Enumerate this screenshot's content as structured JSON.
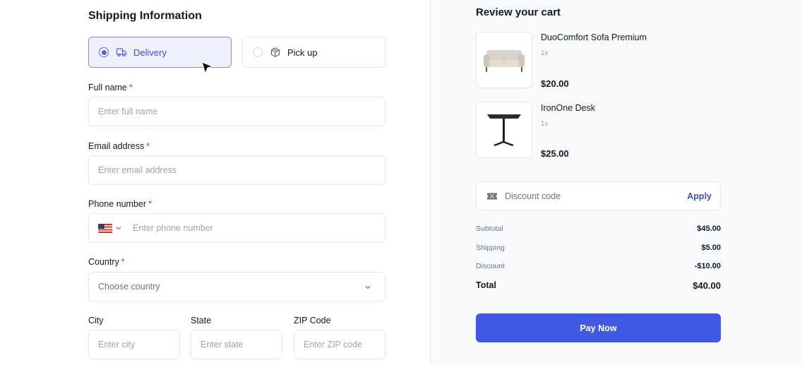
{
  "shipping": {
    "title": "Shipping Information",
    "methods": [
      {
        "label": "Delivery",
        "selected": true,
        "icon": "truck-icon"
      },
      {
        "label": "Pick up",
        "selected": false,
        "icon": "box-icon"
      }
    ],
    "fields": {
      "full_name": {
        "label": "Full name",
        "placeholder": "Enter full name",
        "required": "*"
      },
      "email": {
        "label": "Email address",
        "placeholder": "Enter email address",
        "required": "*"
      },
      "phone": {
        "label": "Phone number",
        "placeholder": "Enter phone number",
        "required": "*",
        "country_flag": "us-flag-icon"
      },
      "country": {
        "label": "Country",
        "placeholder": "Choose country",
        "required": "*"
      },
      "city": {
        "label": "City",
        "placeholder": "Enter city"
      },
      "state": {
        "label": "State",
        "placeholder": "Enter state"
      },
      "zip": {
        "label": "ZIP Code",
        "placeholder": "Enter ZIP code"
      }
    }
  },
  "cart": {
    "title": "Review your cart",
    "items": [
      {
        "name": "DuoComfort Sofa Premium",
        "qty": "1x",
        "price": "$20.00",
        "image": "sofa-image"
      },
      {
        "name": "IronOne Desk",
        "qty": "1x",
        "price": "$25.00",
        "image": "desk-image"
      }
    ],
    "discount": {
      "placeholder": "Discount code",
      "apply_label": "Apply"
    },
    "summary": {
      "subtotal_label": "Subtotal",
      "subtotal": "$45.00",
      "shipping_label": "Shipping",
      "shipping": "$5.00",
      "discount_label": "Discount",
      "discount": "-$10.00",
      "total_label": "Total",
      "total": "$40.00"
    },
    "pay_label": "Pay Now"
  },
  "colors": {
    "accent": "#4158e3",
    "selected_bg": "#eef1fb",
    "required": "#dc2626",
    "right_panel_bg": "#f9fafb"
  }
}
